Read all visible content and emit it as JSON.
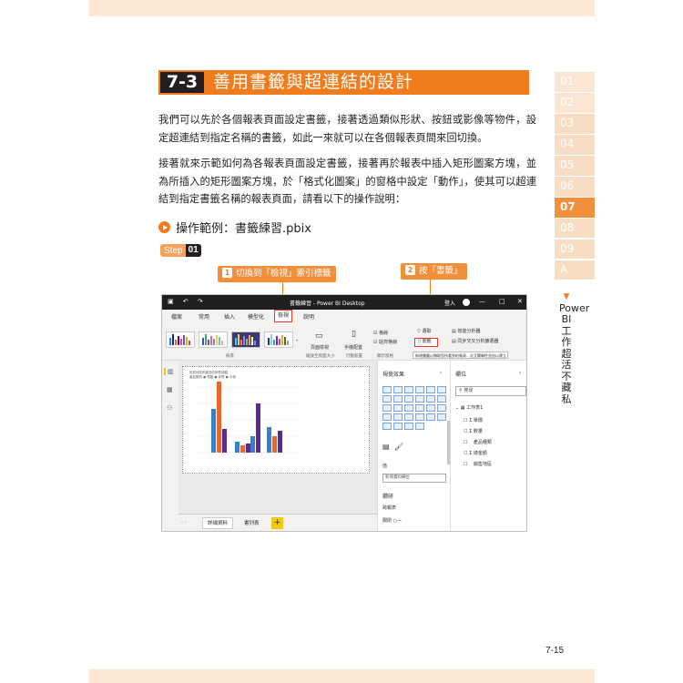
{
  "chapter_tabs": [
    "01",
    "02",
    "03",
    "04",
    "05",
    "06",
    "07",
    "08",
    "09",
    "A"
  ],
  "side_title": "Power BI 工作超活不藏私",
  "section": {
    "number": "7-3",
    "title": "善用書籤與超連結的設計"
  },
  "paragraphs": [
    "我們可以先於各個報表頁面設定書籤，接著透過類似形狀、按鈕或影像等物件，設定超連結到指定名稱的書籤，如此一來就可以在各個報表頁間來回切換。",
    "接著就來示範如何為各報表頁面設定書籤，接著再於報表中插入矩形圖案方塊，並為所插入的矩形圖案方塊，於「格式化圖案」的窗格中設定「動作」，使其可以超連結到指定書籤名稱的報表頁面，請看以下的操作說明："
  ],
  "example": "操作範例：書籤練習.pbix",
  "step": {
    "label": "Step",
    "number": "01"
  },
  "callouts": [
    {
      "badge": "1",
      "text": "切換到「檢視」索引標籤"
    },
    {
      "badge": "2",
      "text": "按「書籤」"
    }
  ],
  "app": {
    "title": "書籤練習 - Power BI Desktop",
    "login": "登入",
    "window_controls": [
      "—",
      "□",
      "✕"
    ],
    "menu": [
      "檔案",
      "常用",
      "插入",
      "模型化",
      "檢視",
      "說明"
    ],
    "selected_menu": "檢視",
    "ribbon": {
      "page_view": "頁面檢視",
      "mobile_layout": "手機配置",
      "group_themes": "佈景",
      "group_scale": "縮放至頁面大小",
      "group_mobile": "行動裝置",
      "group_show": "顯示窗格",
      "gridlines": "格線",
      "snap_to_grid": "貼齊格線",
      "selection": "選取",
      "bookmarks": "書籤",
      "performance": "效能分析器",
      "sync_slicers": "同步交叉分析篩選器",
      "tooltip": "新增書籤以擷取您所看到的報表…交互關聯性並加以建立",
      "selection_tooltip": "選取"
    },
    "canvas": {
      "chart_title": "依據地區和產品的銷售總額",
      "chart_legend": "產品類別 ● 電腦 ● 家電 ● 手機"
    },
    "page_tabs": [
      "詳細資料",
      "書列表"
    ],
    "add_tab": "+",
    "nav_arrows": "‹ ›",
    "viz_pane": {
      "title": "視覺效果",
      "values_label": "值",
      "values_placeholder": "新增資料欄位",
      "drillthrough": "鑽研",
      "cross_report": "跨報表",
      "keep_all": "關閉 ○—"
    },
    "fields_pane": {
      "title": "欄位",
      "search": "搜尋",
      "table": "工作表1",
      "fields": [
        "單價",
        "數量",
        "產品種類",
        "總金額",
        "銷售地區"
      ],
      "field_sigma": [
        true,
        true,
        false,
        true,
        false
      ]
    }
  },
  "page_number": "7-15",
  "colors": {
    "accent": "#f07c1e",
    "tab_active": "#f28f3b",
    "highlight": "#e8382a"
  }
}
